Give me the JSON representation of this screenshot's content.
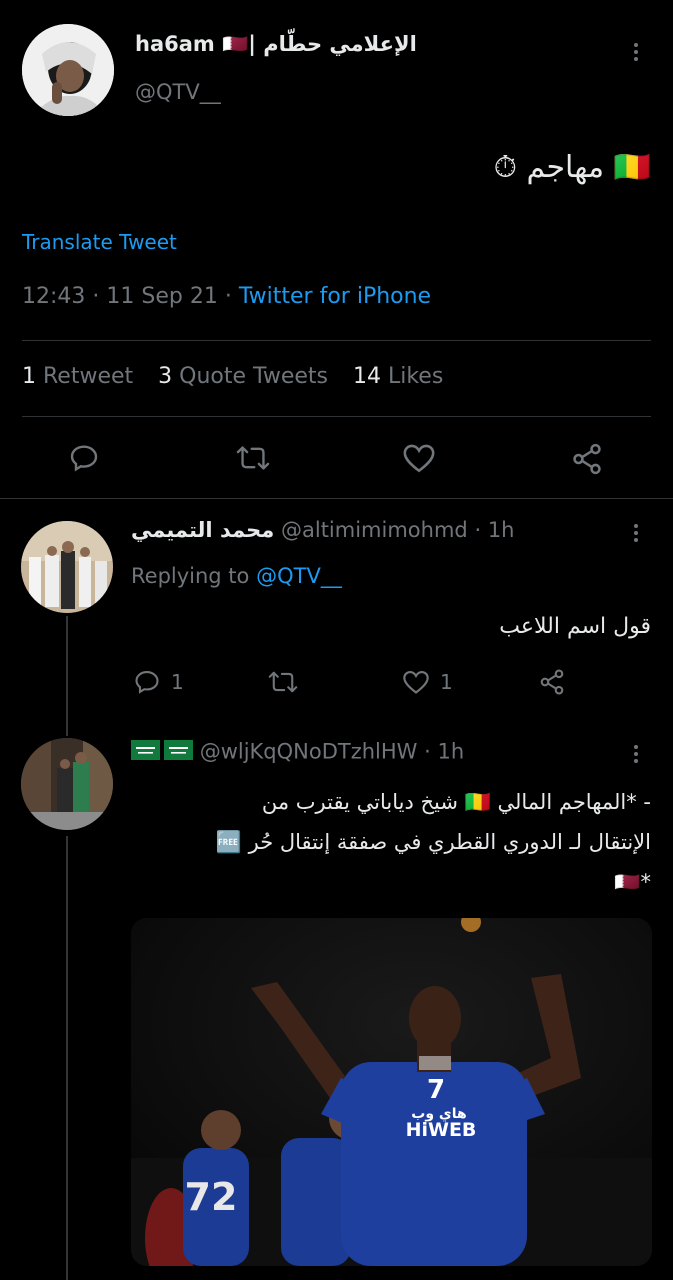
{
  "main_tweet": {
    "display_name": "ha6am 🇶🇦| الإعلامي حطّام",
    "handle": "@QTV__",
    "text": "🇲🇱 مهاجم ⏱",
    "translate_label": "Translate Tweet",
    "time": "12:43",
    "date": "11 Sep 21",
    "client": "Twitter for iPhone",
    "stats": {
      "retweets_count": "1",
      "retweets_label": "Retweet",
      "quotes_count": "3",
      "quotes_label": "Quote Tweets",
      "likes_count": "14",
      "likes_label": "Likes"
    }
  },
  "replies": [
    {
      "display_name": "محمد التميمي",
      "handle": "@altimimimohmd",
      "time": "1h",
      "replying_prefix": "Replying to",
      "replying_to": "@QTV__",
      "text": "قول اسم اللاعب",
      "reply_count": "1",
      "retweet_count": "",
      "like_count": "1"
    },
    {
      "display_name": "🇸🇦🇸🇦",
      "handle": "@wljKqQNoDTzhlHW",
      "time": "1h",
      "text_line1": "- *المهاجم المالي 🇲🇱 شيخ دياباتي يقترب من",
      "text_line2": "الإنتقال لـ الدوري القطري في صفقة إنتقال حُر 🆓",
      "text_line3": "*🇶🇦",
      "image_jersey_number": "7",
      "image_sponsor": "HiWEB",
      "image_sponsor_ar": "هاي وب",
      "image_back_number": "72"
    }
  ],
  "colors": {
    "background": "#000000",
    "text": "#e7e9ea",
    "muted": "#71767b",
    "accent": "#1d9bf0",
    "divider": "#2f3336",
    "jersey": "#1f3f9e"
  }
}
